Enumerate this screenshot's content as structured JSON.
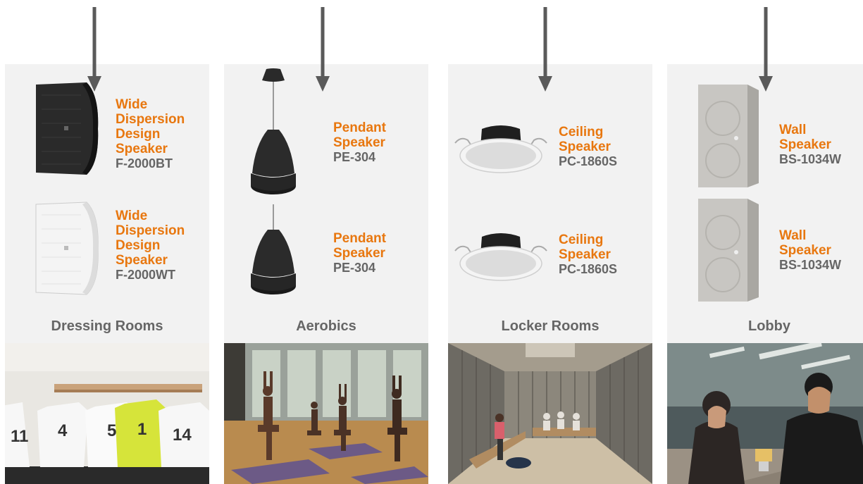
{
  "colors": {
    "accent": "#e8770f",
    "gray_text": "#666666",
    "panel": "#f2f2f2",
    "arrow": "#5a5a5a"
  },
  "columns": [
    {
      "room": "Dressing Rooms",
      "products": [
        {
          "name": [
            "Wide",
            "Dispersion",
            "Design",
            "Speaker"
          ],
          "model": "F-2000BT"
        },
        {
          "name": [
            "Wide",
            "Dispersion",
            "Design",
            "Speaker"
          ],
          "model": "F-2000WT"
        }
      ]
    },
    {
      "room": "Aerobics",
      "products": [
        {
          "name": [
            "Pendant",
            "Speaker"
          ],
          "model": "PE-304"
        },
        {
          "name": [
            "Pendant",
            "Speaker"
          ],
          "model": "PE-304"
        }
      ]
    },
    {
      "room": "Locker Rooms",
      "products": [
        {
          "name": [
            "Ceiling",
            "Speaker"
          ],
          "model": "PC-1860S"
        },
        {
          "name": [
            "Ceiling",
            "Speaker"
          ],
          "model": "PC-1860S"
        }
      ]
    },
    {
      "room": "Lobby",
      "products": [
        {
          "name": [
            "Wall",
            "Speaker"
          ],
          "model": "BS-1034W"
        },
        {
          "name": [
            "Wall",
            "Speaker"
          ],
          "model": "BS-1034W"
        }
      ]
    }
  ],
  "jerseys": [
    "11",
    "4",
    "5",
    "1",
    "14"
  ]
}
